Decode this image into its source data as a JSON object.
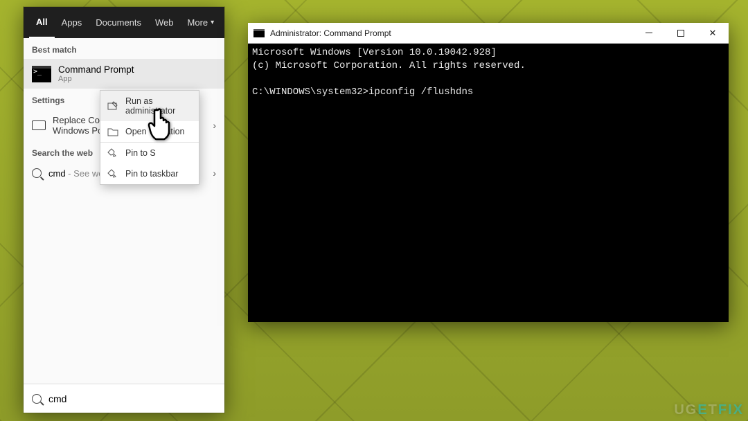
{
  "search": {
    "tabs": {
      "all": "All",
      "apps": "Apps",
      "documents": "Documents",
      "web": "Web",
      "more": "More"
    },
    "sections": {
      "best_match": "Best match",
      "settings": "Settings",
      "search_web": "Search the web"
    },
    "best_match": {
      "title": "Command Prompt",
      "subtitle": "App"
    },
    "settings_item": {
      "line1": "Replace Com",
      "line2": "Windows Pow"
    },
    "web_item": {
      "query": "cmd",
      "suffix": " - See web results"
    },
    "input_value": "cmd"
  },
  "context_menu": {
    "run_admin": "Run as administrator",
    "open_location": "Open",
    "open_location_tail": "ation",
    "pin_start": "Pin to S",
    "pin_taskbar": "Pin to taskbar"
  },
  "cmd_window": {
    "title": "Administrator: Command Prompt",
    "line1": "Microsoft Windows [Version 10.0.19042.928]",
    "line2": "(c) Microsoft Corporation. All rights reserved.",
    "blank": "",
    "prompt": "C:\\WINDOWS\\system32>ipconfig /flushdns"
  },
  "watermark": {
    "a": "UG",
    "b": "E",
    "c": "T",
    "d": "FIX"
  }
}
